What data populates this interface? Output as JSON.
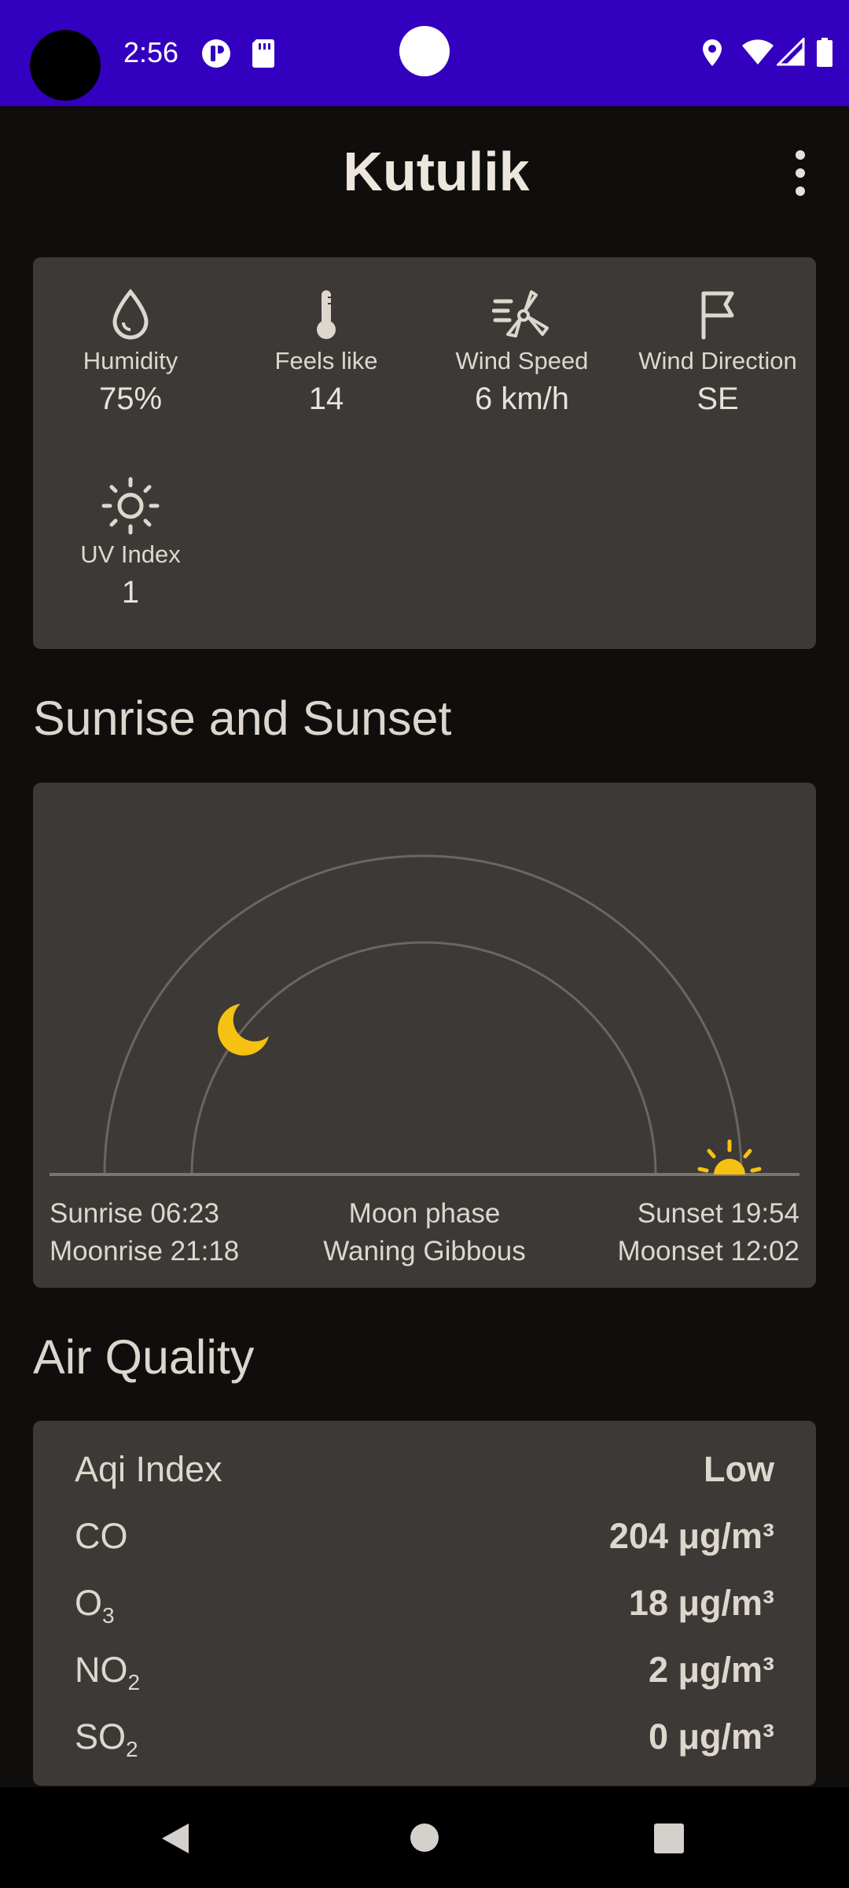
{
  "status_bar": {
    "time": "2:56",
    "color": "#3300bf",
    "icons": [
      "camera-cutout",
      "vpn-icon",
      "sd-card-icon",
      "location-icon",
      "wifi-icon",
      "signal-icon",
      "battery-icon"
    ]
  },
  "app_bar": {
    "title": "Kutulik",
    "menu_icon": "more-vert-icon"
  },
  "details": [
    {
      "label": "Humidity",
      "value": "75%",
      "icon": "water-drop-icon"
    },
    {
      "label": "Feels like",
      "value": "14",
      "icon": "thermometer-icon"
    },
    {
      "label": "Wind Speed",
      "value": "6 km/h",
      "icon": "wind-turbine-icon"
    },
    {
      "label": "Wind Direction",
      "value": "SE",
      "icon": "flag-icon"
    },
    {
      "label": "UV Index",
      "value": "1",
      "icon": "sun-icon"
    }
  ],
  "sun_section": {
    "title": "Sunrise and Sunset",
    "sunrise": "Sunrise 06:23",
    "moonrise": "Moonrise 21:18",
    "moon_phase_label": "Moon phase",
    "moon_phase": "Waning Gibbous",
    "sunset": "Sunset 19:54",
    "moonset": "Moonset 12:02",
    "accent_color": "#f5c112"
  },
  "air_quality": {
    "title": "Air Quality",
    "rows": [
      {
        "label": "Aqi Index",
        "value": "Low"
      },
      {
        "label": "CO",
        "value": "204 μg/m³"
      },
      {
        "label": "O",
        "sub": "3",
        "value": "18 μg/m³"
      },
      {
        "label": "NO",
        "sub": "2",
        "value": "2 μg/m³"
      },
      {
        "label": "SO",
        "sub": "2",
        "value": "0 μg/m³"
      }
    ]
  },
  "nav_bar": {
    "icons": [
      "back-icon",
      "home-icon",
      "recents-icon"
    ]
  }
}
